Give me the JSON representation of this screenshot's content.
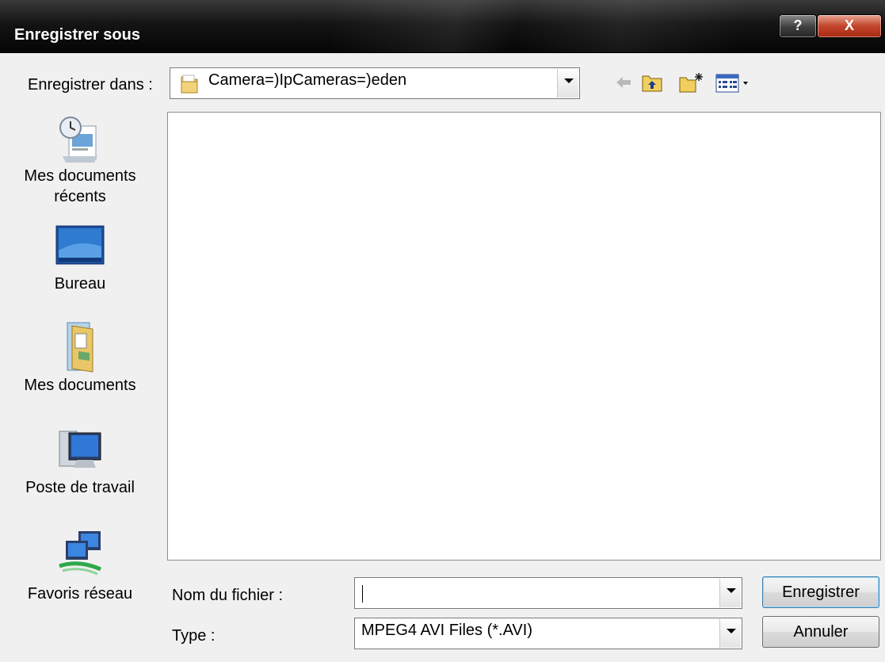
{
  "window": {
    "title": "Enregistrer sous",
    "help_label": "?",
    "close_label": "X"
  },
  "toolbar": {
    "save_in_label": "Enregistrer dans :",
    "save_in_value": "Camera=)IpCameras=)eden"
  },
  "sidebar": {
    "items": [
      {
        "label_line1": "Mes documents",
        "label_line2": "récents",
        "icon": "recent-documents-icon"
      },
      {
        "label_line1": "Bureau",
        "icon": "desktop-icon"
      },
      {
        "label_line1": "Mes documents",
        "icon": "my-documents-icon"
      },
      {
        "label_line1": "Poste de travail",
        "icon": "my-computer-icon"
      },
      {
        "label_line1": "Favoris réseau",
        "icon": "network-places-icon"
      }
    ]
  },
  "form": {
    "filename_label": "Nom du fichier :",
    "filename_value": "",
    "type_label": "Type :",
    "type_value": "MPEG4 AVI Files (*.AVI)"
  },
  "buttons": {
    "save": "Enregistrer",
    "cancel": "Annuler"
  }
}
